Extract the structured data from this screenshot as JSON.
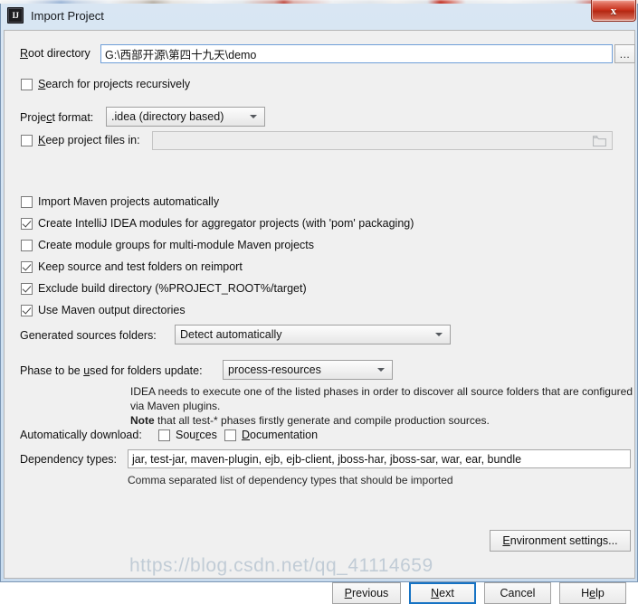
{
  "window": {
    "title": "Import Project",
    "logo_text": "IJ",
    "close_label": "x"
  },
  "root_directory": {
    "label": "Root directory",
    "label_underline": "R",
    "value": "G:\\西部开源\\第四十九天\\demo",
    "browse_label": "...",
    "browse_icon": "ellipsis-icon"
  },
  "search_recursively": {
    "label": "Search for projects recursively",
    "label_underline": "S",
    "checked": false
  },
  "project_format": {
    "label": "Project format:",
    "value": ".idea (directory based)"
  },
  "keep_project_files": {
    "label": "Keep project files in:",
    "label_underline": "K",
    "checked": false,
    "value": "",
    "icon": "folder-icon"
  },
  "options": [
    {
      "label": "Import Maven projects automatically",
      "checked": false
    },
    {
      "label": "Create IntelliJ IDEA modules for aggregator projects (with 'pom' packaging)",
      "checked": true
    },
    {
      "label": "Create module groups for multi-module Maven projects",
      "checked": false
    },
    {
      "label": "Keep source and test folders on reimport",
      "checked": true
    },
    {
      "label": "Exclude build directory (%PROJECT_ROOT%/target)",
      "checked": true
    },
    {
      "label": "Use Maven output directories",
      "checked": true
    }
  ],
  "generated_sources": {
    "label": "Generated sources folders:",
    "value": "Detect automatically"
  },
  "phase": {
    "label": "Phase to be used for folders update:",
    "value": "process-resources"
  },
  "note": {
    "line1": "IDEA needs to execute one of the listed phases in order to discover all source folders that are configured via Maven plugins.",
    "line2_bold": "Note",
    "line2_rest": " that all test-* phases firstly generate and compile production sources."
  },
  "auto_download": {
    "label": "Automatically download:",
    "sources_label": "Sources",
    "sources_checked": false,
    "documentation_label": "Documentation",
    "documentation_checked": false
  },
  "dependency_types": {
    "label": "Dependency types:",
    "value": "jar, test-jar, maven-plugin, ejb, ejb-client, jboss-har, jboss-sar, war, ear, bundle",
    "hint": "Comma separated list of dependency types that should be imported"
  },
  "buttons": {
    "environment_settings": "Environment settings...",
    "previous": "Previous",
    "next": "Next",
    "cancel": "Cancel",
    "help": "Help"
  },
  "watermark": {
    "text": "https://blog.csdn.net/qq_41114659"
  }
}
